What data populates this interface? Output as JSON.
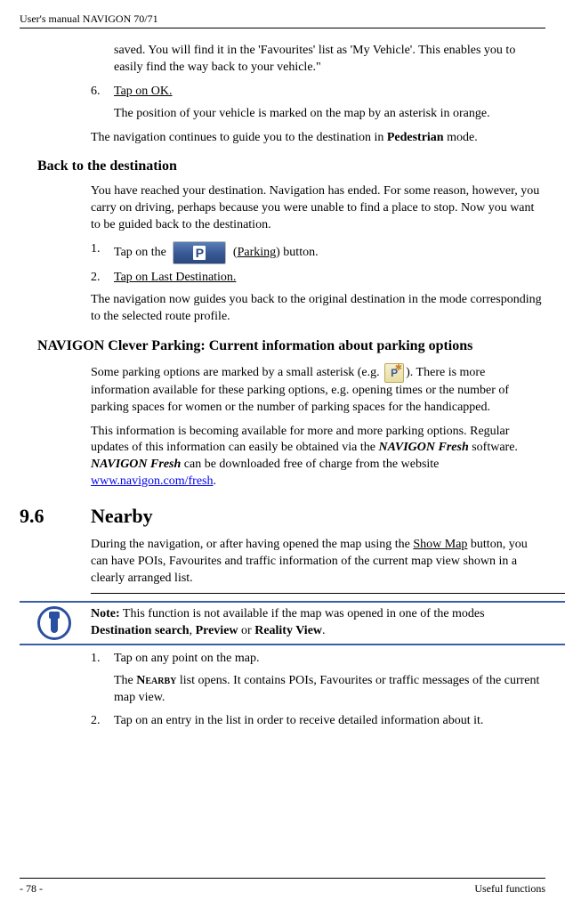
{
  "header": {
    "title": "User's manual NAVIGON 70/71"
  },
  "main": {
    "p_saved": "saved. You will find it in the 'Favourites' list as 'My Vehicle'. This enables you to easily find the way back to your vehicle.\"",
    "step6_num": "6.",
    "step6_text": "Tap on OK.",
    "p_position": "The position of your vehicle is marked on the map by an asterisk in orange.",
    "p_nav_cont_a": "The navigation continues to guide you to the destination in ",
    "p_nav_cont_bold": "Pedestrian",
    "p_nav_cont_b": " mode.",
    "h2_back": "Back to the destination",
    "p_back1": "You have reached your destination. Navigation has ended. For some reason, however, you carry on driving, perhaps because you were unable to find a place to stop. Now you want to be guided back to the destination.",
    "back_step1_num": "1.",
    "back_step1_pre": "Tap on the ",
    "back_step1_mid": " (",
    "back_step1_link": "Parking",
    "back_step1_post": ") button.",
    "back_step2_num": "2.",
    "back_step2_text": "Tap on Last Destination.",
    "p_back2": "The navigation now guides you back to the original destination in the mode corresponding to the selected route profile.",
    "h2_clever": "NAVIGON Clever Parking: Current information about parking options",
    "p_clever1_a": "Some parking options are marked by a small asterisk (e.g. ",
    "p_clever1_b": "). There is more information available for these parking options, e.g. opening times or the number of parking spaces for women or the number of parking spaces for the handicapped.",
    "p_clever2_a": "This information is becoming available for more and more parking options. Regular updates of this information can easily be obtained via the ",
    "p_clever2_b": "NAVIGON Fresh",
    "p_clever2_c": " software. ",
    "p_clever2_d": "NAVIGON Fresh",
    "p_clever2_e": " can be downloaded free of charge from the website ",
    "p_clever2_link": "www.navigon.com/fresh",
    "p_clever2_f": ".",
    "section_num": "9.6",
    "section_title": "Nearby",
    "p_nearby_a": "During the navigation, or after having opened the map using the ",
    "p_nearby_link": "Show Map",
    "p_nearby_b": " button, you can have POIs, Favourites and traffic information of the current map view shown in a clearly arranged list.",
    "note_bold": "Note:",
    "note_a": " This function is not available if the map was opened in one of the modes ",
    "note_b1": "Destination search",
    "note_c": ", ",
    "note_b2": "Preview",
    "note_d": " or ",
    "note_b3": "Reality View",
    "note_e": ".",
    "nb_step1_num": "1.",
    "nb_step1_text": "Tap on any point on the map.",
    "p_nearby2_a": "The ",
    "p_nearby2_sc": "Nearby",
    "p_nearby2_b": " list opens. It contains POIs, Favourites or traffic messages of the current map view.",
    "nb_step2_num": "2.",
    "nb_step2_text": "Tap on an entry in the list in order to receive detailed information about it."
  },
  "footer": {
    "page": "- 78 -",
    "section": "Useful functions"
  }
}
